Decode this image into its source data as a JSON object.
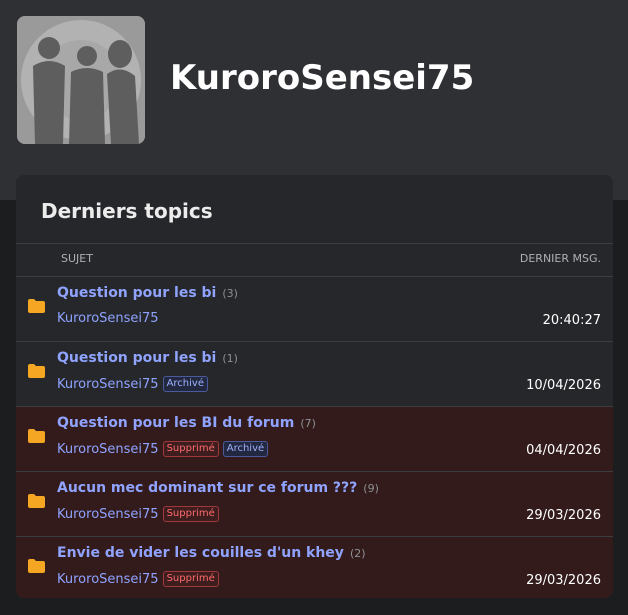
{
  "profile": {
    "username": "KuroroSensei75"
  },
  "panel": {
    "title": "Derniers topics",
    "col_subject": "SUJET",
    "col_last": "DERNIER MSG."
  },
  "colors": {
    "link": "#8fa3ff",
    "folder": "#f5a623",
    "deleted_bg": "#331b1c"
  },
  "topics": [
    {
      "title": "Question pour les bi",
      "count": "(3)",
      "author": "KuroroSensei75",
      "badges": [],
      "date": "20:40:27",
      "deleted": false
    },
    {
      "title": "Question pour les bi",
      "count": "(1)",
      "author": "KuroroSensei75",
      "badges": [
        "Archivé"
      ],
      "date": "10/04/2026",
      "deleted": false
    },
    {
      "title": "Question pour les BI du forum",
      "count": "(7)",
      "author": "KuroroSensei75",
      "badges": [
        "Supprimé",
        "Archivé"
      ],
      "date": "04/04/2026",
      "deleted": true
    },
    {
      "title": "Aucun mec dominant sur ce forum ???",
      "count": "(9)",
      "author": "KuroroSensei75",
      "badges": [
        "Supprimé"
      ],
      "date": "29/03/2026",
      "deleted": true
    },
    {
      "title": "Envie de vider les couilles d'un khey",
      "count": "(2)",
      "author": "KuroroSensei75",
      "badges": [
        "Supprimé"
      ],
      "date": "29/03/2026",
      "deleted": true
    }
  ]
}
